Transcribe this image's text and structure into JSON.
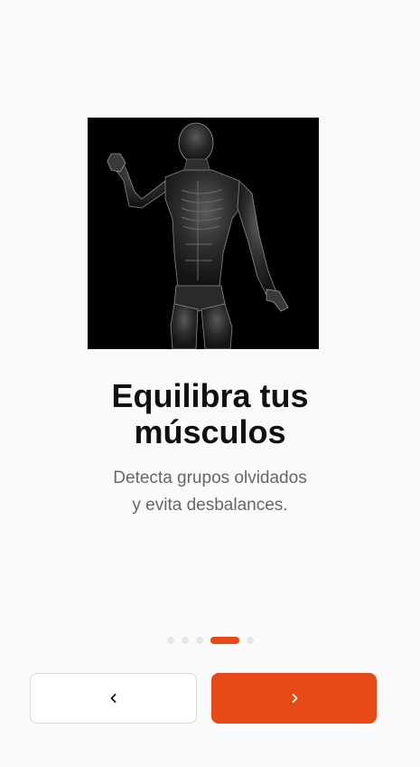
{
  "onboarding": {
    "image": {
      "subject": "anatomy-muscles-figure-icon"
    },
    "title_line1": "Equilibra tus",
    "title_line2": "músculos",
    "subtitle_line1": "Detecta grupos olvidados",
    "subtitle_line2": "y evita desbalances.",
    "pager": {
      "total_pages": 5,
      "current_page": 4
    }
  },
  "nav": {
    "back_icon": "chevron-left-icon",
    "next_icon": "chevron-right-icon"
  },
  "colors": {
    "accent": "#e84a17",
    "background": "#fafafa",
    "title": "#111111",
    "subtitle": "#666666",
    "dot_inactive": "#e6e6e6"
  }
}
